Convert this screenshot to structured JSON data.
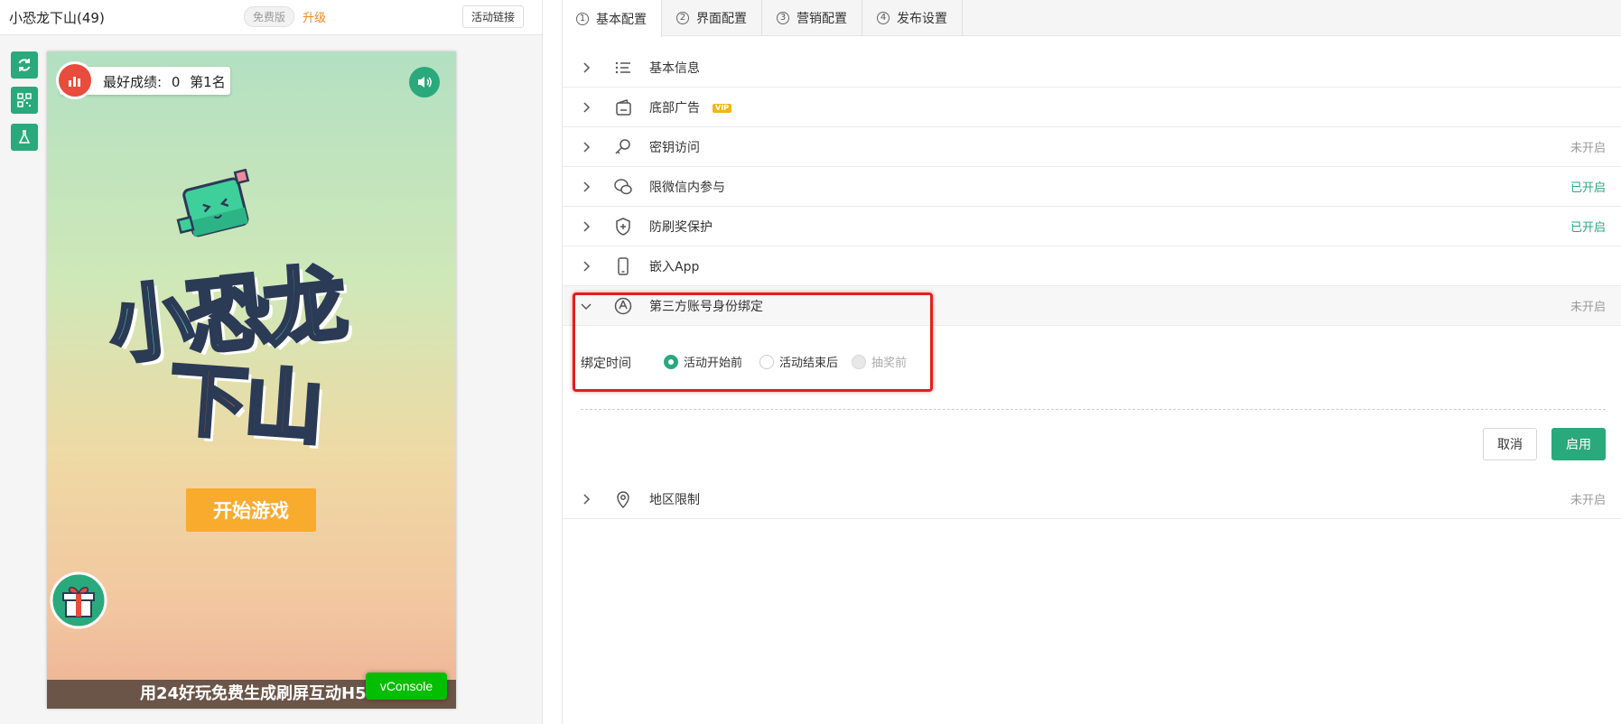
{
  "header": {
    "title": "小恐龙下山(49)",
    "free_badge": "免费版",
    "upgrade": "升级",
    "activity_link": "活动链接"
  },
  "toolbar": {
    "icons": [
      "refresh-icon",
      "qrcode-icon",
      "flask-icon"
    ]
  },
  "game_preview": {
    "score_label": "最好成绩:",
    "score_value": "0",
    "rank": "第1名",
    "logo_line1": "小恐龙",
    "logo_line2": "下山",
    "start_button": "开始游戏",
    "footer_text": "用24好玩免费生成刷屏互动H5",
    "vconsole": "vConsole"
  },
  "tabs": [
    {
      "num": "1",
      "label": "基本配置",
      "active": true
    },
    {
      "num": "2",
      "label": "界面配置",
      "active": false
    },
    {
      "num": "3",
      "label": "营销配置",
      "active": false
    },
    {
      "num": "4",
      "label": "发布设置",
      "active": false
    }
  ],
  "settings": [
    {
      "label": "基本信息",
      "status": "",
      "icon": "list-icon"
    },
    {
      "label": "底部广告",
      "status": "",
      "icon": "ad-icon",
      "vip": "VIP"
    },
    {
      "label": "密钥访问",
      "status": "未开启",
      "icon": "key-icon"
    },
    {
      "label": "限微信内参与",
      "status": "已开启",
      "icon": "wechat-icon"
    },
    {
      "label": "防刷奖保护",
      "status": "已开启",
      "icon": "shield-icon"
    },
    {
      "label": "嵌入App",
      "status": "",
      "icon": "mobile-icon"
    },
    {
      "label": "第三方账号身份绑定",
      "status": "未开启",
      "icon": "account-icon"
    },
    {
      "label": "地区限制",
      "status": "未开启",
      "icon": "location-icon"
    }
  ],
  "bind_panel": {
    "label": "绑定时间",
    "options": [
      "活动开始前",
      "活动结束后",
      "抽奖前"
    ],
    "selected": "活动开始前",
    "cancel": "取消",
    "enable": "启用"
  },
  "colors": {
    "accent": "#2aa97c",
    "highlight": "#e0201b",
    "start_button": "#f9ab2e"
  }
}
